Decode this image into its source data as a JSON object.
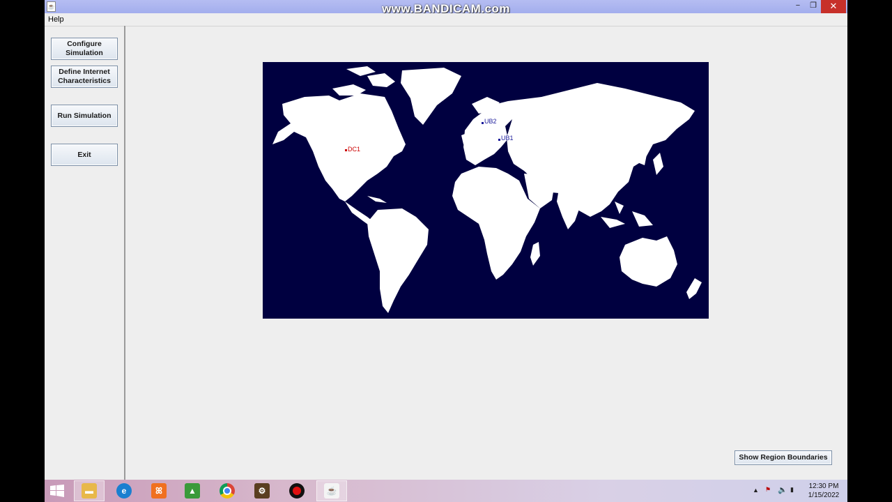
{
  "window": {
    "watermark": "www.BANDICAM.com",
    "minimize": "−",
    "maximize": "❐",
    "close": "✕"
  },
  "menu": {
    "help": "Help"
  },
  "sidebar": {
    "configure_line1": "Configure",
    "configure_line2": "Simulation",
    "define_line1": "Define Internet",
    "define_line2": "Characteristics",
    "run": "Run Simulation",
    "exit": "Exit"
  },
  "map": {
    "background_color": "#000040",
    "land_color": "#ffffff",
    "markers": [
      {
        "label": "DC1",
        "color": "#cc0000"
      },
      {
        "label": "UB2",
        "color": "#1a1a9a"
      },
      {
        "label": "UB1",
        "color": "#1a1a9a"
      }
    ]
  },
  "region_button": "Show Region Boundaries",
  "taskbar": {
    "apps": [
      {
        "name": "file-explorer-icon",
        "glyph": "▬",
        "color": "#e8b84a"
      },
      {
        "name": "edge-icon",
        "glyph": "e",
        "color": "#1a7fd0"
      },
      {
        "name": "xampp-icon",
        "glyph": "ꕤ",
        "color": "#f07020"
      },
      {
        "name": "chart-app-icon",
        "glyph": "▲",
        "color": "#3a9a3a"
      },
      {
        "name": "chrome-icon",
        "glyph": "●",
        "color": "#dd4433"
      },
      {
        "name": "settings-app-icon",
        "glyph": "⚙",
        "color": "#7a5a30"
      },
      {
        "name": "bandicam-record-icon",
        "glyph": "●",
        "color": "#222222"
      },
      {
        "name": "java-icon",
        "glyph": "☕",
        "color": "#e07020"
      }
    ],
    "time": "12:30 PM",
    "date": "1/15/2022"
  }
}
